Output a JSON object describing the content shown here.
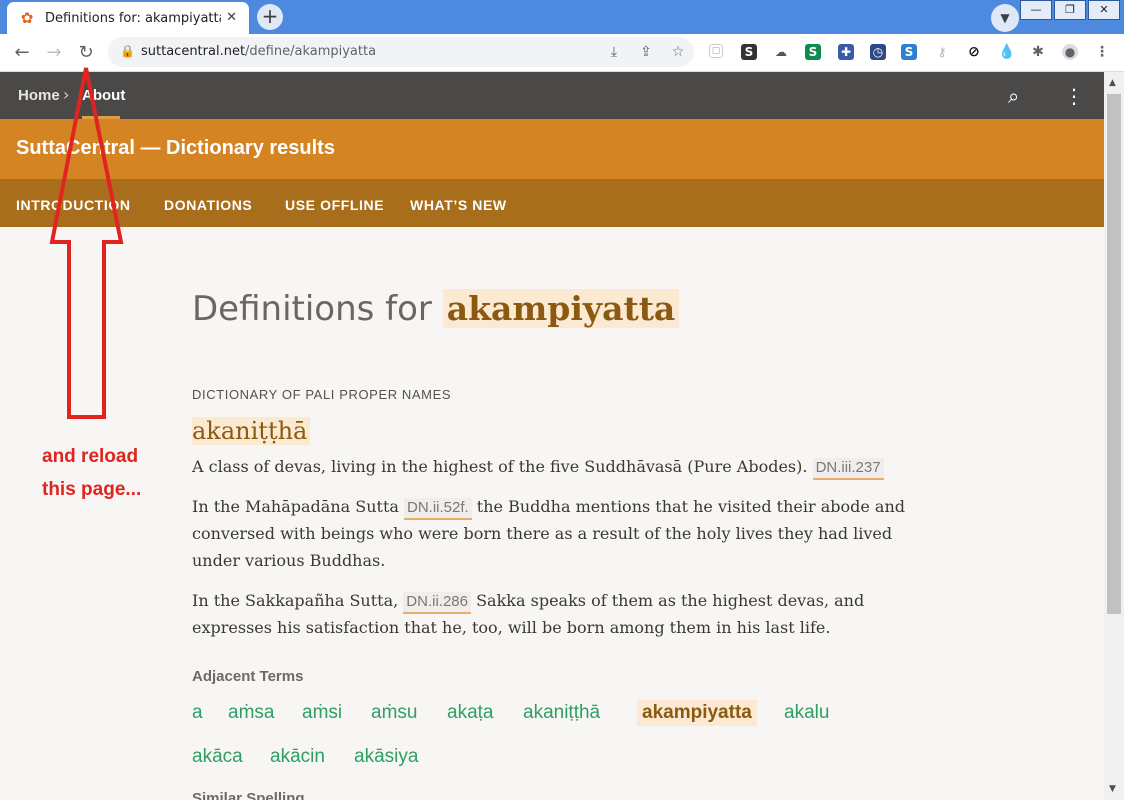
{
  "browser": {
    "tab_title": "Definitions for: akampiyatta",
    "url_host": "suttacentral.net",
    "url_path": "/define/akampiyatta",
    "new_tab_symbol": "+",
    "close_symbol": "✕",
    "window_buttons": [
      "—",
      "❐",
      "✕"
    ]
  },
  "site": {
    "breadcrumb": [
      "Home",
      "About"
    ],
    "title": "SuttaCentral — Dictionary results",
    "subnav": [
      "INTRODUCTION",
      "DONATIONS",
      "USE OFFLINE",
      "WHAT’S NEW"
    ]
  },
  "main": {
    "heading_prefix": "Definitions for",
    "heading_term": "akampiyatta",
    "dictionary_name": "DICTIONARY OF PALI PROPER NAMES",
    "entry_word": "akaniṭṭhā",
    "p1_text": "A class of devas, living in the highest of the five Suddhāvasā (Pure Abodes).",
    "p1_ref": "DN.iii.237",
    "p2_text_a": "In the Mahāpadāna Sutta",
    "p2_ref": "DN.ii.52f.",
    "p2_text_b": "the Buddha mentions that he visited their abode and conversed with beings who were born there as a result of the holy lives they had lived under various Buddhas.",
    "p3_text_a": "In the Sakkapañha Sutta,",
    "p3_ref": "DN.ii.286",
    "p3_text_b": "Sakka speaks of them as the highest devas, and expresses his satisfaction that he, too, will be born among them in his last life.",
    "adjacent_heading": "Adjacent Terms",
    "adjacent_terms": [
      "a",
      "aṁsa",
      "aṁsi",
      "aṁsu",
      "akaṭa",
      "akaniṭṭhā",
      "akampiyatta",
      "akalu",
      "akāca",
      "akācin",
      "akāsiya"
    ],
    "similar_heading": "Similar Spelling"
  },
  "annotation": {
    "line1": "and reload",
    "line2": "this page..."
  },
  "colors": {
    "chrome_blue": "#4d89de",
    "topbar": "#4a4948",
    "title_orange": "#d58424",
    "subnav_brown": "#a86e1c",
    "link_green": "#2f9e63",
    "annotation_red": "#e0241f"
  }
}
